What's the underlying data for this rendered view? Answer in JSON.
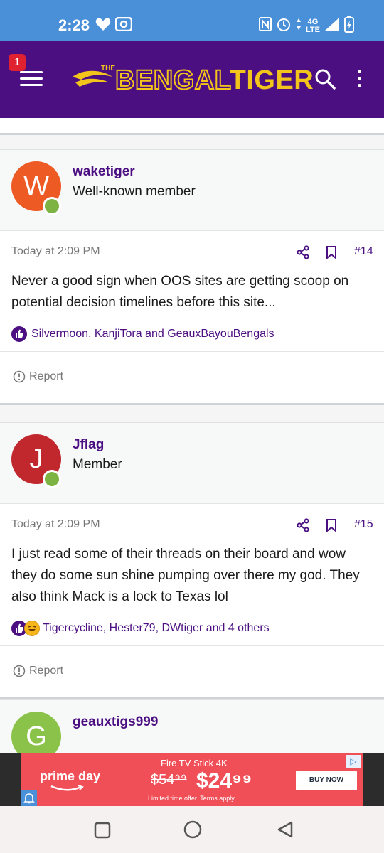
{
  "status_bar": {
    "time": "2:28",
    "network": "4G\nLTE"
  },
  "header": {
    "notification_count": "1",
    "logo_the": "THE",
    "logo_word_a": "BENGAL",
    "logo_word_b": "TIGER"
  },
  "colors": {
    "brand_purple": "#4b0f82",
    "brand_gold": "#f3c41a",
    "online_green": "#7cb342"
  },
  "posts": [
    {
      "username": "waketiger",
      "user_title": "Well-known member",
      "avatar_letter": "W",
      "avatar_color": "#ee5a24",
      "date": "Today at 2:09 PM",
      "post_number": "#14",
      "message": "Never a good sign when OOS sites are getting scoop on potential decision timelines before this site...",
      "reactions": "Silvermoon, KanjiTora and GeauxBayouBengals",
      "reaction_icons": [
        "like-icon"
      ],
      "report_label": "Report"
    },
    {
      "username": "Jflag",
      "user_title": "Member",
      "avatar_letter": "J",
      "avatar_color": "#c0282d",
      "date": "Today at 2:09 PM",
      "post_number": "#15",
      "message": "I just read some of their threads on their board and wow they do some sun shine pumping over there my god. They also think Mack is a lock to Texas lol",
      "reactions": "Tigercycline, Hester79, DWtiger and 4 others",
      "reaction_icons": [
        "like-icon",
        "laugh-icon"
      ],
      "report_label": "Report"
    },
    {
      "username": "geauxtigs999",
      "avatar_letter": "G",
      "avatar_color": "#8bc34a"
    }
  ],
  "ad": {
    "brand": "prime day",
    "product": "Fire TV Stick 4K",
    "old_price": "$54⁹⁹",
    "new_price": "$24⁹⁹",
    "fine_print": "Limited time offer. Terms apply.",
    "cta": "BUY NOW"
  }
}
